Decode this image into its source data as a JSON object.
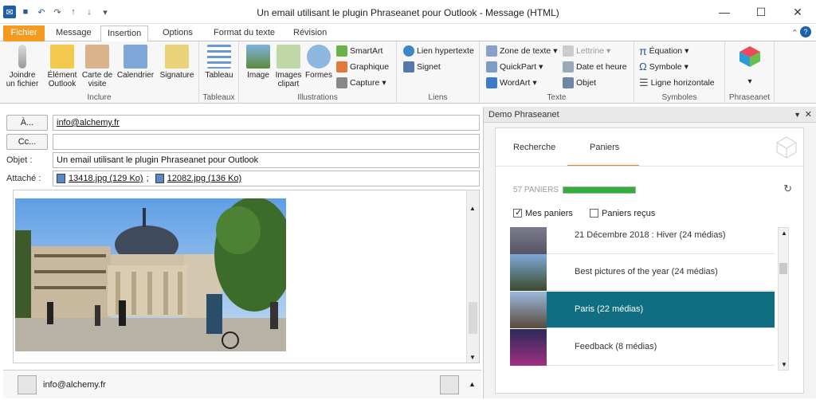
{
  "window": {
    "title": "Un email utilisant le plugin Phraseanet pour Outlook  -  Message (HTML)"
  },
  "tabs": [
    "Fichier",
    "Message",
    "Insertion",
    "Options",
    "Format du texte",
    "Révision"
  ],
  "ribbon": {
    "inclure": {
      "label": "Inclure",
      "joindre": "Joindre un fichier",
      "element": "Élément Outlook",
      "carte": "Carte de visite",
      "calendrier": "Calendrier",
      "signature": "Signature"
    },
    "tableaux": {
      "label": "Tableaux",
      "tableau": "Tableau"
    },
    "illustrations": {
      "label": "Illustrations",
      "image": "Image",
      "clipart": "Images clipart",
      "formes": "Formes",
      "smartart": "SmartArt",
      "graphique": "Graphique",
      "capture": "Capture"
    },
    "liens": {
      "label": "Liens",
      "hyper": "Lien hypertexte",
      "signet": "Signet"
    },
    "texte": {
      "label": "Texte",
      "zone": "Zone de texte",
      "lettrine": "Lettrine",
      "quickpart": "QuickPart",
      "date": "Date et heure",
      "wordart": "WordArt",
      "objet": "Objet"
    },
    "symboles": {
      "label": "Symboles",
      "equation": "Équation",
      "symbole": "Symbole",
      "ligne": "Ligne horizontale"
    },
    "phraseanet": {
      "label": "Phraseanet"
    }
  },
  "compose": {
    "to_button": "À...",
    "to_value": "info@alchemy.fr",
    "cc_button": "Cc...",
    "cc_value": "",
    "subject_label": "Objet :",
    "subject_value": "Un email utilisant le plugin Phraseanet pour Outlook",
    "attach_label": "Attaché :",
    "att1": "13418.jpg (129 Ko)",
    "att2": "12082.jpg (136 Ko)"
  },
  "people": {
    "email": "info@alchemy.fr"
  },
  "panel": {
    "title": "Demo Phraseanet",
    "tab_search": "Recherche",
    "tab_baskets": "Paniers",
    "count": "57 PANIERS",
    "count_progress": 1.0,
    "mine": "Mes paniers",
    "received": "Paniers reçus",
    "items": [
      {
        "label": "21 Décembre 2018 : Hiver (24 médias)"
      },
      {
        "label": "Best pictures of the year (24 médias)"
      },
      {
        "label": "Paris (22 médias)"
      },
      {
        "label": "Feedback (8 médias)"
      }
    ]
  }
}
